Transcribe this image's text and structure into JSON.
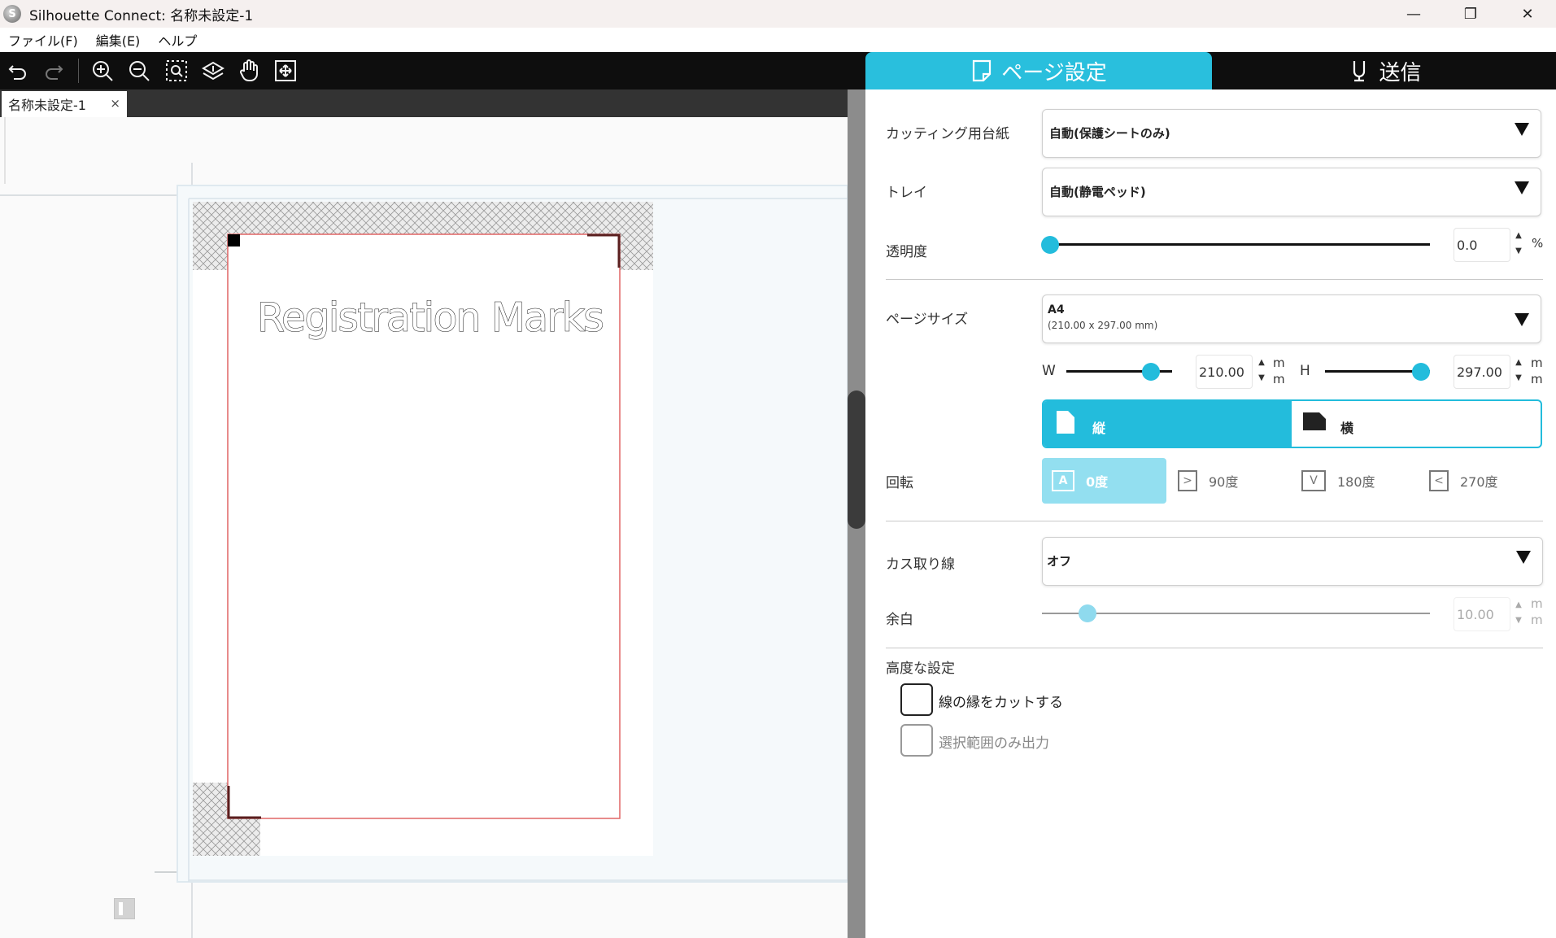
{
  "window": {
    "title": "Silhouette Connect: 名称未設定-1",
    "logo_letter": "S",
    "minimize": "—",
    "maximize": "❐",
    "close": "✕"
  },
  "menu": [
    "ファイル(F)",
    "編集(E)",
    "ヘルプ"
  ],
  "toolbar_icons": [
    "undo-icon",
    "redo-icon",
    "zoom-in-icon",
    "zoom-out-icon",
    "zoom-selection-icon",
    "fit-to-mat-icon",
    "pan-hand-icon",
    "fit-to-page-icon"
  ],
  "panel_tabs": {
    "page_setup": "ページ設定",
    "send": "送信"
  },
  "document_tab": {
    "name": "名称未設定-1",
    "close": "×"
  },
  "canvas": {
    "page_text": "Registration Marks"
  },
  "settings": {
    "cutting_mat": {
      "label": "カッティング用台紙",
      "value": "自動(保護シートのみ)"
    },
    "tray": {
      "label": "トレイ",
      "value": "自動(静電ペッド)"
    },
    "transparency": {
      "label": "透明度",
      "value": "0.0",
      "unit": "%",
      "level": 0
    },
    "page_size": {
      "label": "ページサイズ",
      "value": "A4",
      "detail": "(210.00 x 297.00 mm)"
    },
    "width": {
      "label": "W",
      "value": "210.00",
      "unit_top": "m",
      "unit_bottom": "m"
    },
    "height": {
      "label": "H",
      "value": "297.00",
      "unit_top": "m",
      "unit_bottom": "m"
    },
    "orientation": {
      "portrait": "縦",
      "landscape": "横",
      "selected": "縦"
    },
    "rotation": {
      "label": "回転",
      "options": [
        {
          "label": "0度",
          "glyph": "A"
        },
        {
          "label": "90度",
          "glyph": ">"
        },
        {
          "label": "180度",
          "glyph": "V"
        },
        {
          "label": "270度",
          "glyph": "<"
        }
      ],
      "selected": "0度"
    },
    "trim_line": {
      "label": "カス取り線",
      "value": "オフ"
    },
    "margin": {
      "label": "余白",
      "value": "10.00",
      "unit_top": "m",
      "unit_bottom": "m"
    },
    "advanced": {
      "label": "高度な設定",
      "cut_line_edges": "線の縁をカットする",
      "selection_only": "選択範囲のみ出力"
    },
    "spin_up": "▲",
    "spin_down": "▼"
  },
  "colors": {
    "accent": "#23bcdc",
    "toolbar_bg": "#0e0e0e",
    "cut_border": "#e06565"
  }
}
